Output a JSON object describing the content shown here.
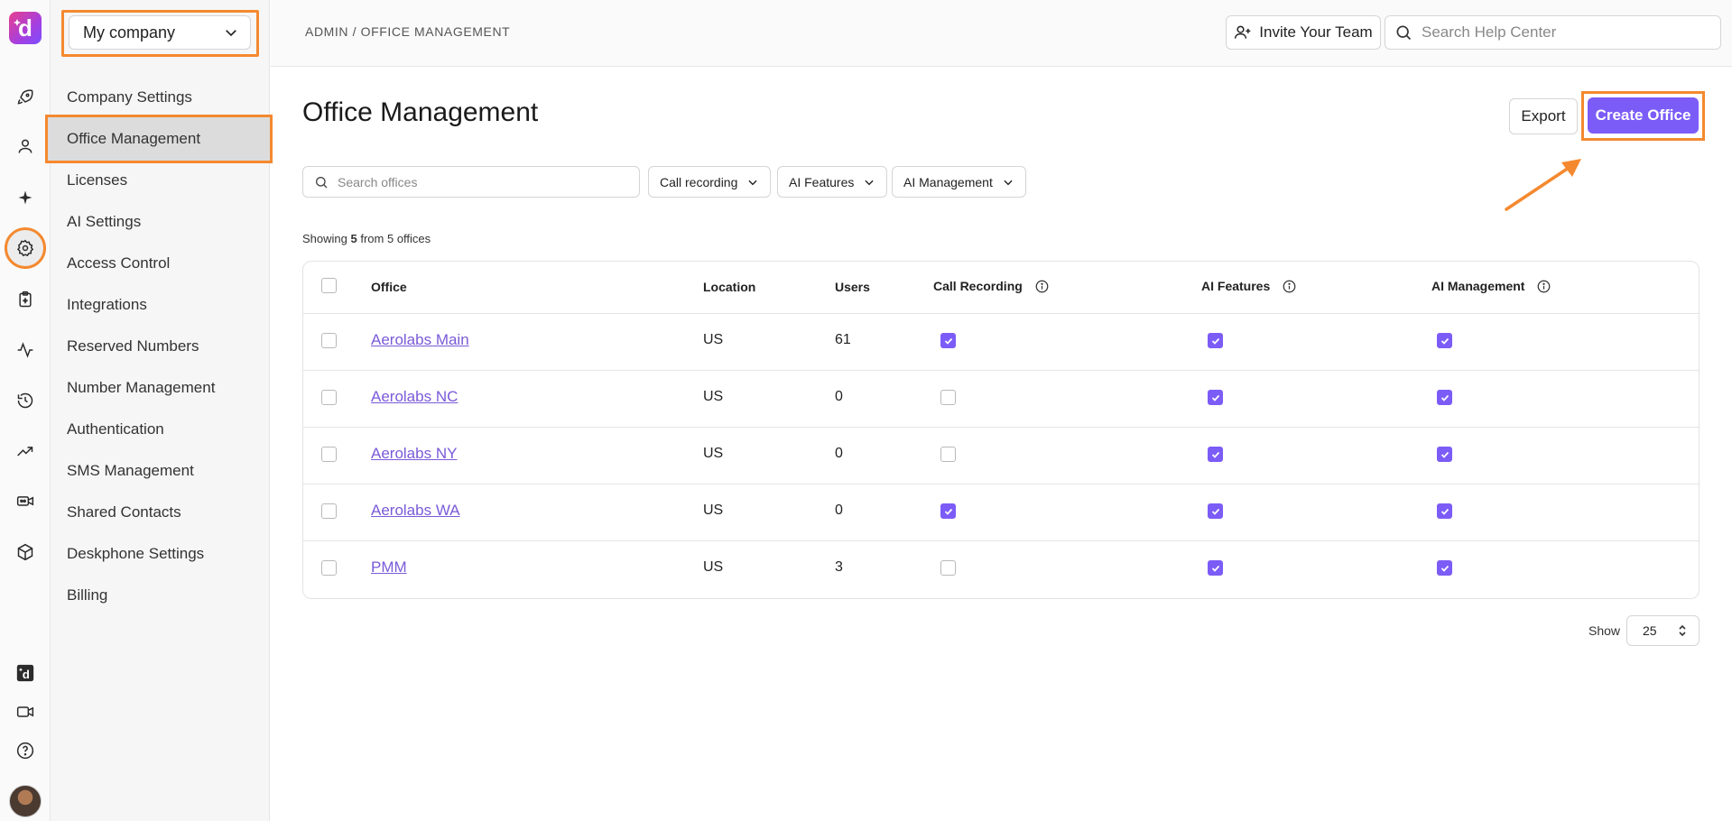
{
  "company": {
    "selected": "My company"
  },
  "sidebar": {
    "items": [
      {
        "label": "Company Settings"
      },
      {
        "label": "Office Management"
      },
      {
        "label": "Licenses"
      },
      {
        "label": "AI Settings"
      },
      {
        "label": "Access Control"
      },
      {
        "label": "Integrations"
      },
      {
        "label": "Reserved Numbers"
      },
      {
        "label": "Number Management"
      },
      {
        "label": "Authentication"
      },
      {
        "label": "SMS Management"
      },
      {
        "label": "Shared Contacts"
      },
      {
        "label": "Deskphone Settings"
      },
      {
        "label": "Billing"
      }
    ],
    "active": "Office Management"
  },
  "rail": {
    "icons": [
      "rocket-icon",
      "person-icon",
      "sparkle-icon",
      "gear-icon",
      "clipboard-icon",
      "activity-icon",
      "history-icon",
      "trending-icon",
      "video-bot-icon",
      "cube-icon",
      "app-logo-icon",
      "video-icon",
      "help-icon"
    ],
    "active": "gear-icon"
  },
  "header": {
    "breadcrumb": "ADMIN / OFFICE MANAGEMENT",
    "invite_label": "Invite Your Team",
    "help_search_placeholder": "Search Help Center"
  },
  "main": {
    "title": "Office Management",
    "export_label": "Export",
    "create_label": "Create Office",
    "search_placeholder": "Search offices",
    "filters": [
      "Call recording",
      "AI Features",
      "AI Management"
    ],
    "showing_prefix": "Showing",
    "showing_count": "5",
    "showing_suffix": "from 5 offices",
    "columns": [
      "Office",
      "Location",
      "Users",
      "Call Recording",
      "AI Features",
      "AI Management"
    ],
    "rows": [
      {
        "office": "Aerolabs Main",
        "location": "US",
        "users": "61",
        "call_recording": true,
        "ai_features": true,
        "ai_management": true
      },
      {
        "office": "Aerolabs NC",
        "location": "US",
        "users": "0",
        "call_recording": false,
        "ai_features": true,
        "ai_management": true
      },
      {
        "office": "Aerolabs NY",
        "location": "US",
        "users": "0",
        "call_recording": false,
        "ai_features": true,
        "ai_management": true
      },
      {
        "office": "Aerolabs WA",
        "location": "US",
        "users": "0",
        "call_recording": true,
        "ai_features": true,
        "ai_management": true
      },
      {
        "office": "PMM",
        "location": "US",
        "users": "3",
        "call_recording": false,
        "ai_features": true,
        "ai_management": true
      }
    ],
    "page_size_label": "Show",
    "page_size": "25"
  },
  "colors": {
    "accent": "#7c5cf7",
    "highlight": "#f4892f",
    "link": "#7a5ad8"
  }
}
